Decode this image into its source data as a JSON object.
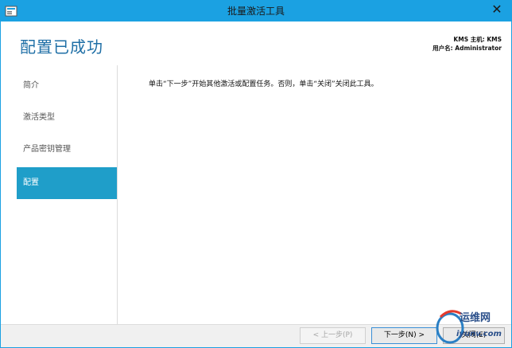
{
  "window": {
    "title": "批量激活工具",
    "close_glyph": "✕"
  },
  "header": {
    "page_title": "配置已成功",
    "host_line": "KMS 主机: KMS",
    "user_line": "用户名: Administrator"
  },
  "sidebar": {
    "items": [
      {
        "label": "简介",
        "active": false
      },
      {
        "label": "激活类型",
        "active": false
      },
      {
        "label": "产品密钥管理",
        "active": false
      },
      {
        "label": "配置",
        "active": true
      }
    ]
  },
  "content": {
    "message": "单击“下一步”开始其他激活或配置任务。否则，单击“关闭”关闭此工具。"
  },
  "footer": {
    "prev_label": "< 上一步(P)",
    "next_label": "下一步(N) >",
    "close_label": "关闭(E)"
  },
  "watermark": {
    "line1": "运维网",
    "line2": "iyunv.com"
  },
  "colors": {
    "titlebar": "#1ba1e2",
    "accent": "#1f9ec9",
    "title_text": "#1f6fa6"
  },
  "icons": {
    "app": "app-icon",
    "close": "close-icon"
  }
}
